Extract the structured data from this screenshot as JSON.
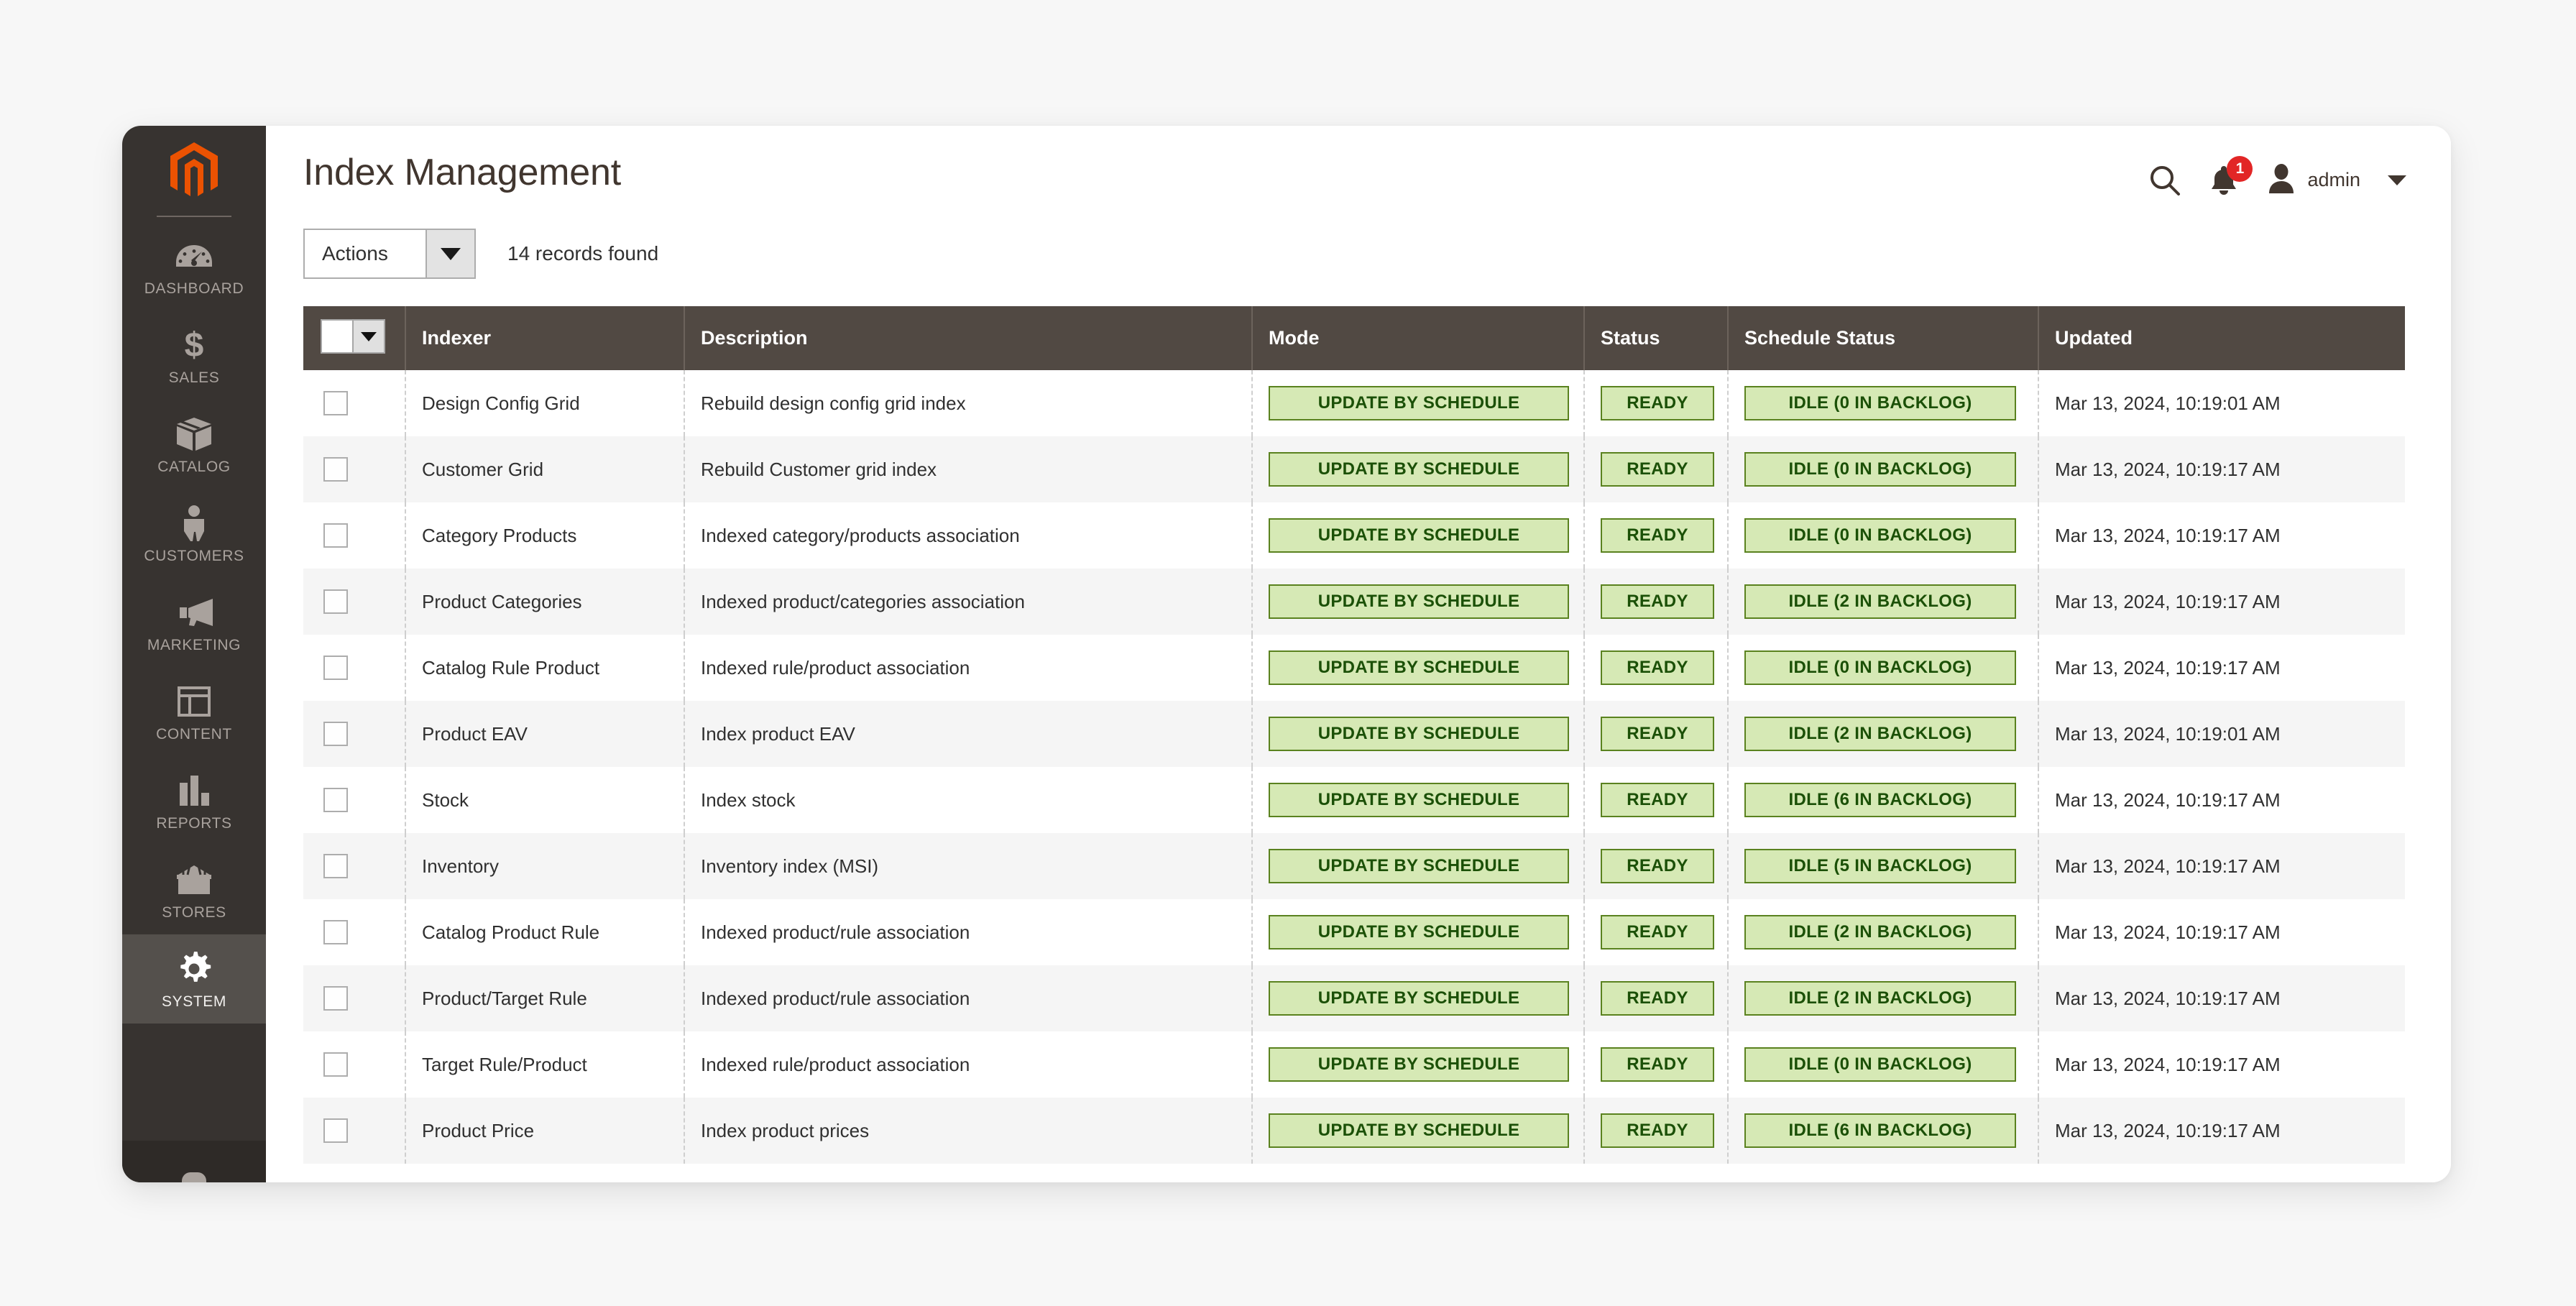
{
  "app": {
    "logo_icon": "magento-logo-icon",
    "accent_color": "#eb5202",
    "sidebar_bg": "#373330",
    "header_bg": "#514943",
    "badge_bg": "#d6e9b5",
    "badge_border": "#5a821f",
    "badge_text_color": "#1b5007",
    "notification_color": "#e22626"
  },
  "sidebar": {
    "items": [
      {
        "label": "DASHBOARD",
        "icon": "gauge-icon",
        "active": false
      },
      {
        "label": "SALES",
        "icon": "dollar-icon",
        "active": false
      },
      {
        "label": "CATALOG",
        "icon": "box-icon",
        "active": false
      },
      {
        "label": "CUSTOMERS",
        "icon": "person-icon",
        "active": false
      },
      {
        "label": "MARKETING",
        "icon": "megaphone-icon",
        "active": false
      },
      {
        "label": "CONTENT",
        "icon": "layout-icon",
        "active": false
      },
      {
        "label": "REPORTS",
        "icon": "bar-chart-icon",
        "active": false
      },
      {
        "label": "STORES",
        "icon": "storefront-icon",
        "active": false
      },
      {
        "label": "SYSTEM",
        "icon": "gear-icon",
        "active": true
      }
    ]
  },
  "header": {
    "title": "Index Management",
    "search_icon": "search-icon",
    "notifications_icon": "bell-icon",
    "notifications_count": "1",
    "avatar_icon": "user-avatar-icon",
    "admin_name": "admin",
    "caret_icon": "chevron-down-icon"
  },
  "toolbar": {
    "actions_label": "Actions",
    "actions_caret_icon": "caret-down-icon",
    "records_found": "14 records found"
  },
  "grid": {
    "columns": [
      "Indexer",
      "Description",
      "Mode",
      "Status",
      "Schedule Status",
      "Updated"
    ],
    "rows": [
      {
        "indexer": "Design Config Grid",
        "description": "Rebuild design config grid index",
        "mode": "UPDATE BY SCHEDULE",
        "status": "READY",
        "schedule_status": "IDLE (0 IN BACKLOG)",
        "updated": "Mar 13, 2024, 10:19:01 AM"
      },
      {
        "indexer": "Customer Grid",
        "description": "Rebuild Customer grid index",
        "mode": "UPDATE BY SCHEDULE",
        "status": "READY",
        "schedule_status": "IDLE (0 IN BACKLOG)",
        "updated": "Mar 13, 2024, 10:19:17 AM"
      },
      {
        "indexer": "Category Products",
        "description": "Indexed category/products association",
        "mode": "UPDATE BY SCHEDULE",
        "status": "READY",
        "schedule_status": "IDLE (0 IN BACKLOG)",
        "updated": "Mar 13, 2024, 10:19:17 AM"
      },
      {
        "indexer": "Product Categories",
        "description": "Indexed product/categories association",
        "mode": "UPDATE BY SCHEDULE",
        "status": "READY",
        "schedule_status": "IDLE (2 IN BACKLOG)",
        "updated": "Mar 13, 2024, 10:19:17 AM"
      },
      {
        "indexer": "Catalog Rule Product",
        "description": "Indexed rule/product association",
        "mode": "UPDATE BY SCHEDULE",
        "status": "READY",
        "schedule_status": "IDLE (0 IN BACKLOG)",
        "updated": "Mar 13, 2024, 10:19:17 AM"
      },
      {
        "indexer": "Product EAV",
        "description": "Index product EAV",
        "mode": "UPDATE BY SCHEDULE",
        "status": "READY",
        "schedule_status": "IDLE (2 IN BACKLOG)",
        "updated": "Mar 13, 2024, 10:19:01 AM"
      },
      {
        "indexer": "Stock",
        "description": "Index stock",
        "mode": "UPDATE BY SCHEDULE",
        "status": "READY",
        "schedule_status": "IDLE (6 IN BACKLOG)",
        "updated": "Mar 13, 2024, 10:19:17 AM"
      },
      {
        "indexer": "Inventory",
        "description": "Inventory index (MSI)",
        "mode": "UPDATE BY SCHEDULE",
        "status": "READY",
        "schedule_status": "IDLE (5 IN BACKLOG)",
        "updated": "Mar 13, 2024, 10:19:17 AM"
      },
      {
        "indexer": "Catalog Product Rule",
        "description": "Indexed product/rule association",
        "mode": "UPDATE BY SCHEDULE",
        "status": "READY",
        "schedule_status": "IDLE (2 IN BACKLOG)",
        "updated": "Mar 13, 2024, 10:19:17 AM"
      },
      {
        "indexer": "Product/Target Rule",
        "description": "Indexed product/rule association",
        "mode": "UPDATE BY SCHEDULE",
        "status": "READY",
        "schedule_status": "IDLE (2 IN BACKLOG)",
        "updated": "Mar 13, 2024, 10:19:17 AM"
      },
      {
        "indexer": "Target Rule/Product",
        "description": "Indexed rule/product association",
        "mode": "UPDATE BY SCHEDULE",
        "status": "READY",
        "schedule_status": "IDLE (0 IN BACKLOG)",
        "updated": "Mar 13, 2024, 10:19:17 AM"
      },
      {
        "indexer": "Product Price",
        "description": "Index product prices",
        "mode": "UPDATE BY SCHEDULE",
        "status": "READY",
        "schedule_status": "IDLE (6 IN BACKLOG)",
        "updated": "Mar 13, 2024, 10:19:17 AM"
      }
    ]
  }
}
